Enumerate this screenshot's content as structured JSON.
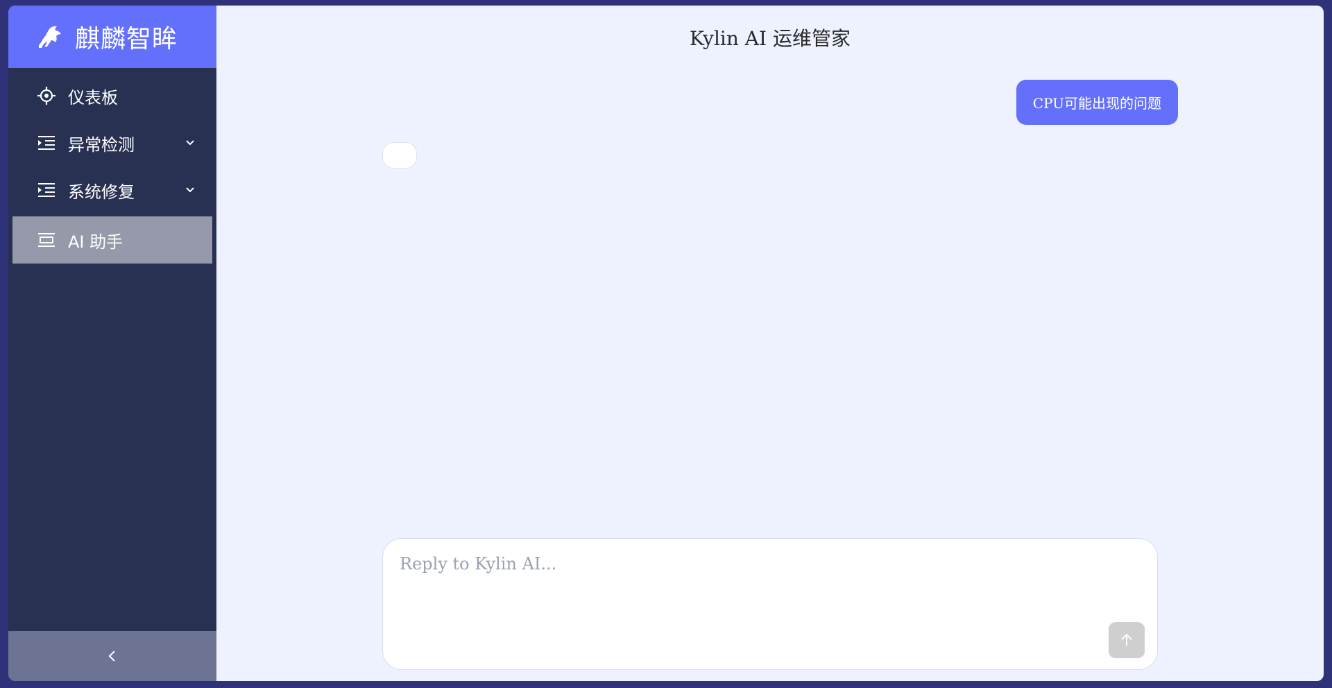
{
  "brand": {
    "name": "麒麟智眸",
    "logo_icon": "kylin-logo-icon"
  },
  "sidebar": {
    "items": [
      {
        "label": "仪表板",
        "icon": "crosshair-icon",
        "expandable": false,
        "active": false
      },
      {
        "label": "异常检测",
        "icon": "indent-list-icon",
        "expandable": true,
        "active": false
      },
      {
        "label": "系统修复",
        "icon": "indent-list-icon",
        "expandable": true,
        "active": false
      },
      {
        "label": "AI 助手",
        "icon": "panel-icon",
        "expandable": false,
        "active": true
      }
    ],
    "collapse_label": "<"
  },
  "chat": {
    "title": "Kylin AI 运维管家",
    "messages": [
      {
        "role": "user",
        "text": "CPU可能出现的问题"
      },
      {
        "role": "assistant",
        "text": ""
      }
    ],
    "input": {
      "placeholder": "Reply to Kylin AI...",
      "value": ""
    },
    "send_icon": "arrow-up-icon"
  },
  "colors": {
    "brand_bg": "#6370fb",
    "sidebar_bg": "#283152",
    "active_item_bg": "#9599a9",
    "user_bubble": "#6570fa",
    "main_bg": "#edf2fe",
    "outer_bg": "#2f3179"
  }
}
